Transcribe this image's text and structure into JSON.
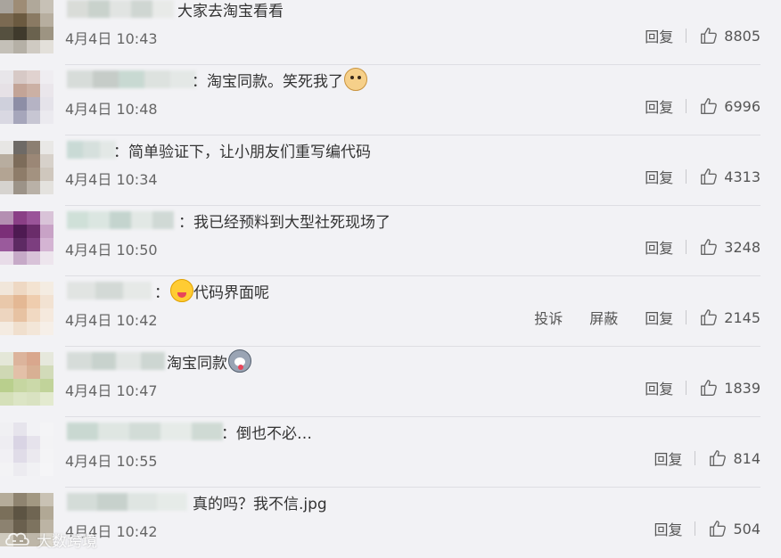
{
  "reply_label": "回复",
  "report_label": "投诉",
  "block_label": "屏蔽",
  "like_icon": "thumbs-up-outline-icon",
  "colors": {
    "background": "#f2f2f5",
    "text": "#333333",
    "meta": "#666666",
    "divider": "#dedee3"
  },
  "comments": [
    {
      "text": "大家去淘宝看看",
      "emoji": null,
      "time": "4月4日 10:43",
      "likes": "8805",
      "show_report_block": false,
      "avatar_palette": [
        "#a9a49d",
        "#9e8c75",
        "#b0a89a",
        "#c7c1b6",
        "#7b6a52",
        "#6b5a40",
        "#8a7a63",
        "#b7ae9f",
        "#55503f",
        "#3f3a2c",
        "#6a624e",
        "#9d9482",
        "#c4c0b8",
        "#b5b0a6",
        "#cfcac2",
        "#e3e0da"
      ],
      "name_palette": [
        "#d9dcd8",
        "#c9d2cc",
        "#e1e4e2",
        "#cfd6d2",
        "#e8eae8"
      ]
    },
    {
      "text": "：淘宝同款。笑死我了",
      "emoji": "doge-emoji",
      "time": "4月4日 10:48",
      "likes": "6996",
      "show_report_block": false,
      "avatar_palette": [
        "#e8e6ea",
        "#d7c9c6",
        "#e0d2cf",
        "#efedf1",
        "#e6e1e6",
        "#c3a497",
        "#cbb0a4",
        "#eae6eb",
        "#cfd0dc",
        "#8d8ea6",
        "#b5b3c4",
        "#e5e3ea",
        "#d9d8e2",
        "#a6a6bb",
        "#c7c6d3",
        "#ebeaef"
      ],
      "name_palette": [
        "#d7dcd9",
        "#c6ccc8",
        "#c8d9d2",
        "#dde2df",
        "#e4e8e6"
      ]
    },
    {
      "text": "：简单验证下，让小朋友们重写编代码",
      "emoji": null,
      "time": "4月4日 10:34",
      "likes": "4313",
      "show_report_block": false,
      "avatar_palette": [
        "#e7e6e4",
        "#6e6a66",
        "#8c7f72",
        "#e9e8e6",
        "#b8ad9f",
        "#7d6c5a",
        "#9b8776",
        "#d7d1ca",
        "#b3a493",
        "#8e7c69",
        "#a39280",
        "#cfc7bd",
        "#d6d3cf",
        "#9c9388",
        "#b9b1a7",
        "#e4e2de"
      ],
      "name_palette": [
        "#c9dad5",
        "#d6e0dd",
        "#e3e8e6"
      ]
    },
    {
      "text": "：我已经预料到大型社死现场了",
      "emoji": null,
      "time": "4月4日 10:50",
      "likes": "3248",
      "show_report_block": false,
      "avatar_palette": [
        "#b48fb2",
        "#8a3f86",
        "#9a5499",
        "#d9c3d8",
        "#7b2f78",
        "#4e1a52",
        "#6a2c6a",
        "#c8a2c6",
        "#9a5a9c",
        "#5d2a63",
        "#7c3e7f",
        "#d4b4d3",
        "#e8dce8",
        "#c6a9c7",
        "#d8c2d8",
        "#ede5ed"
      ],
      "name_palette": [
        "#cfe0d8",
        "#dbe6e1",
        "#c4d4ce",
        "#e2e8e5",
        "#d0d9d5"
      ]
    },
    {
      "text": "代码界面呢",
      "emoji": "yum-emoji",
      "time": "4月4日 10:42",
      "likes": "2145",
      "show_report_block": true,
      "avatar_palette": [
        "#f1e6da",
        "#eed8c3",
        "#f3e3d1",
        "#f4ece2",
        "#e9c8aa",
        "#e4b894",
        "#efcdae",
        "#f2e2d2",
        "#edd5bf",
        "#e7c2a2",
        "#f1d9c2",
        "#f5e9dd",
        "#f4ebe1",
        "#f0dfcd",
        "#f3e6d8",
        "#f6efe8"
      ],
      "name_palette": [
        "#e1e4e2",
        "#d3d9d6",
        "#e6e9e7"
      ]
    },
    {
      "text": "淘宝同款",
      "emoji": "husky-emoji",
      "time": "4月4日 10:47",
      "likes": "1839",
      "show_report_block": false,
      "avatar_palette": [
        "#e4e7d8",
        "#dcb49c",
        "#d9a78d",
        "#e6e8dc",
        "#cfd8b4",
        "#e3c0a8",
        "#d8b094",
        "#d2dbb9",
        "#b9cf8d",
        "#c6d6a1",
        "#cbd9a9",
        "#c1d39a",
        "#d5e0b9",
        "#dce5c5",
        "#d9e2c1",
        "#e3eacf"
      ],
      "name_palette": [
        "#d6dcd9",
        "#c8d2cd",
        "#e2e6e4",
        "#cdd6d2"
      ]
    },
    {
      "text": "：倒也不必…",
      "emoji": null,
      "time": "4月4日 10:55",
      "likes": "814",
      "show_report_block": false,
      "avatar_palette": [
        "#f0f0f3",
        "#e6e4ec",
        "#f2f2f5",
        "#f4f4f6",
        "#eeedf2",
        "#d9d4e4",
        "#e6e3ec",
        "#f3f3f5",
        "#f1f0f4",
        "#e0dce8",
        "#ebe9ef",
        "#f4f4f6",
        "#f3f3f5",
        "#ecebf0",
        "#f1f1f4",
        "#f5f5f7"
      ],
      "name_palette": [
        "#c9d8d1",
        "#dfe6e2",
        "#d2dcd7",
        "#e6ebe8",
        "#cfdad4"
      ]
    },
    {
      "text": "真的吗？我不信.jpg",
      "emoji": null,
      "time": "4月4日 10:42",
      "likes": "504",
      "show_report_block": false,
      "avatar_palette": [
        "#b5ac9a",
        "#8f8470",
        "#a29882",
        "#c9c2b4",
        "#7a6f5a",
        "#5d5443",
        "#6f6552",
        "#b1a895",
        "#8c8270",
        "#6a604e",
        "#7d735f",
        "#bcb4a4",
        "#cfcabe",
        "#aaa292",
        "#bdb6a8",
        "#dcd8ce"
      ],
      "name_palette": [
        "#d4dcd8",
        "#c7d1cc",
        "#dfe5e2",
        "#e6ebe8"
      ]
    }
  ],
  "watermark": {
    "text": "大数跨境",
    "icon": "cloud-logo-icon"
  }
}
